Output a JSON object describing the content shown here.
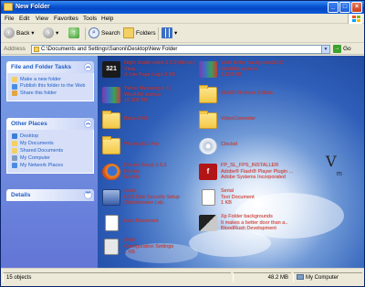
{
  "window": {
    "title": "New Folder"
  },
  "menu": [
    "File",
    "Edit",
    "View",
    "Favorites",
    "Tools",
    "Help"
  ],
  "toolbar": {
    "back": "Back",
    "search": "Search",
    "folders": "Folders"
  },
  "address": {
    "label": "Address",
    "path": "C:\\Documents and Settings\\Sanoni\\Desktop\\New Folder",
    "go": "Go"
  },
  "panels": {
    "tasks": {
      "title": "File and Folder Tasks",
      "items": [
        "Make a new folder",
        "Publish this folder to the Web",
        "Share this folder"
      ]
    },
    "places": {
      "title": "Other Places",
      "items": [
        "Desktop",
        "My Documents",
        "Shared Documents",
        "My Computer",
        "My Network Places"
      ]
    },
    "details": {
      "title": "Details"
    }
  },
  "files": [
    {
      "lines": [
        "Night studio video 1.0.0 (Movie)",
        "Vista",
        "X-Lite Page Logo 3 KB"
      ],
      "icon": "321-media-icon"
    },
    {
      "lines": [
        "Vista folder backgrounds101",
        "WinRAR archive",
        "1,193 KB"
      ],
      "icon": "winrar-icon"
    },
    {
      "lines": [
        "Yahoo Messenger 10",
        "WinRAR archive",
        "16,105 KB"
      ],
      "icon": "winrar-icon"
    },
    {
      "lines": [
        "WinXP H Home Edition"
      ],
      "icon": "folder-icon"
    },
    {
      "lines": [
        "Bday-2006"
      ],
      "icon": "folder-icon"
    },
    {
      "lines": [
        "VideoConverter"
      ],
      "icon": "folder-icon"
    },
    {
      "lines": [
        "Winamp5.0 Pro"
      ],
      "icon": "folder-icon"
    },
    {
      "lines": [
        "Clockid"
      ],
      "icon": "cd-icon"
    },
    {
      "lines": [
        "Firefox Setup 3.5.3",
        "Firefox",
        "Mozilla"
      ],
      "icon": "firefox-icon"
    },
    {
      "lines": [
        "FP_SL_FPS_INSTALLER",
        "Adobe® Flash® Player Plugin ...",
        "Adobe Systems Incorporated"
      ],
      "icon": "flash-icon"
    },
    {
      "lines": [
        "setup",
        "USB Disk Security Setup",
        "Zbshareware Lab."
      ],
      "icon": "setup-icon"
    },
    {
      "lines": [
        "Serial",
        "Text Document",
        "1 KB"
      ],
      "icon": "text-icon"
    },
    {
      "lines": [
        "New Document"
      ],
      "icon": "document-icon"
    },
    {
      "lines": [
        "Xp Folder backgrounds",
        "It makes a better door than a..",
        "BloodRush Development"
      ],
      "icon": "folder-bg-icon"
    },
    {
      "lines": [
        "Gtalk",
        "Configuration Settings",
        "1 KB"
      ],
      "icon": "settings-icon"
    }
  ],
  "status": {
    "objects": "15 objects",
    "size": "48.2 MB",
    "location": "My Computer"
  }
}
